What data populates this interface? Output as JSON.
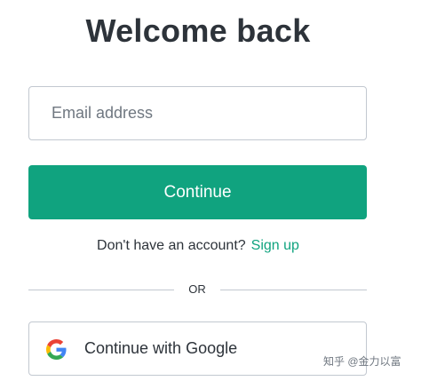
{
  "title": "Welcome back",
  "email": {
    "placeholder": "Email address",
    "value": ""
  },
  "continue_label": "Continue",
  "signup": {
    "prompt": "Don't have an account?",
    "link_label": "Sign up"
  },
  "divider_label": "OR",
  "google": {
    "label": "Continue with Google",
    "icon": "google-icon"
  },
  "watermark": "知乎 @金力以富",
  "colors": {
    "accent": "#10a37f",
    "text": "#2d333a",
    "border": "#c2c8d0"
  }
}
